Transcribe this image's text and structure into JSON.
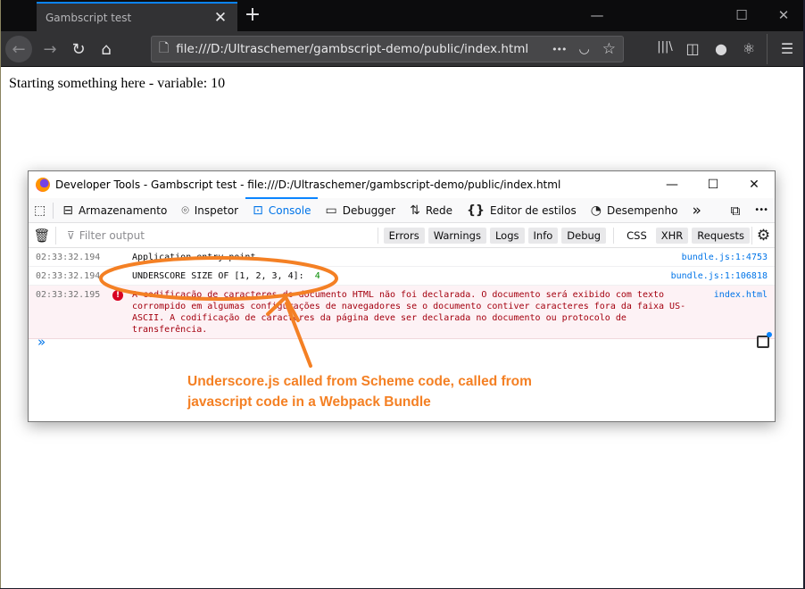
{
  "browser": {
    "tab_title": "Gambscript test",
    "url": "file:///D:/Ultraschemer/gambscript-demo/public/index.html",
    "icons": {
      "back": "arrow-left-icon",
      "forward": "arrow-right-icon",
      "reload": "reload-icon",
      "home": "home-icon",
      "page": "page-icon",
      "more": "ellipsis-icon",
      "pocket": "pocket-icon",
      "bookmark": "star-icon",
      "library": "library-icon",
      "sidebar": "sidebar-icon",
      "account": "account-icon",
      "react": "react-devtools-icon",
      "menu": "hamburger-icon"
    },
    "glyphs": {
      "close": "✕",
      "new_tab": "+",
      "minimize": "—",
      "maximize": "☐",
      "win_close": "✕",
      "back": "←",
      "forward": "→",
      "reload": "↻",
      "home": "⌂",
      "page": "🗋",
      "more": "•••",
      "pocket": "◡",
      "star": "☆",
      "library": "|||\\",
      "sidebar": "◫",
      "account": "●",
      "react": "⚛",
      "menu": "☰"
    }
  },
  "page": {
    "text": "Starting something here - variable: 10"
  },
  "devtools": {
    "title": "Developer Tools - Gambscript test - file:///D:/Ultraschemer/gambscript-demo/public/index.html",
    "tabs": [
      {
        "label": "Armazenamento",
        "icon": "storage-icon",
        "glyph": "⊟"
      },
      {
        "label": "Inspetor",
        "icon": "inspector-icon",
        "glyph": "⌾"
      },
      {
        "label": "Console",
        "icon": "console-icon",
        "glyph": "⊡",
        "active": true
      },
      {
        "label": "Debugger",
        "icon": "debugger-icon",
        "glyph": "▭"
      },
      {
        "label": "Rede",
        "icon": "network-icon",
        "glyph": "⇅"
      },
      {
        "label": "Editor de estilos",
        "icon": "style-editor-icon",
        "glyph": "{}"
      },
      {
        "label": "Desempenho",
        "icon": "performance-icon",
        "glyph": "◔"
      }
    ],
    "more_tabs_glyph": "»",
    "picker_glyph": "⬚",
    "dock_glyph": "⧉",
    "menu_glyph": "•••",
    "filter_placeholder": "Filter output",
    "filter_glyph": "⊽",
    "trash_glyph": "🗑",
    "settings_glyph": "⚙",
    "level_filters": [
      "Errors",
      "Warnings",
      "Logs",
      "Info",
      "Debug"
    ],
    "extra_filters": [
      {
        "label": "CSS",
        "active": false
      },
      {
        "label": "XHR",
        "active": true
      },
      {
        "label": "Requests",
        "active": true
      }
    ],
    "messages": [
      {
        "timestamp": "02:33:32.194",
        "text": "Application entry point.",
        "source": "bundle.js:1:4753",
        "level": "log"
      },
      {
        "timestamp": "02:33:32.194",
        "text": "UNDERSCORE SIZE OF [1, 2, 3, 4]:",
        "value": "4",
        "source": "bundle.js:1:106818",
        "level": "log"
      },
      {
        "timestamp": "02:33:32.195",
        "text": "A codificação de caracteres do documento HTML não foi declarada. O documento será exibido com texto corrompido em algumas configurações de navegadores se o documento contiver caracteres fora da faixa US-ASCII. A codificação de caracteres da página deve ser declarada no documento ou protocolo de transferência.",
        "source": "index.html",
        "level": "error"
      }
    ],
    "prompt_glyph": "»"
  },
  "annotation": {
    "line1": "Underscore.js called from Scheme code, called from",
    "line2": "javascript code in a Webpack Bundle",
    "color": "#f48024"
  }
}
